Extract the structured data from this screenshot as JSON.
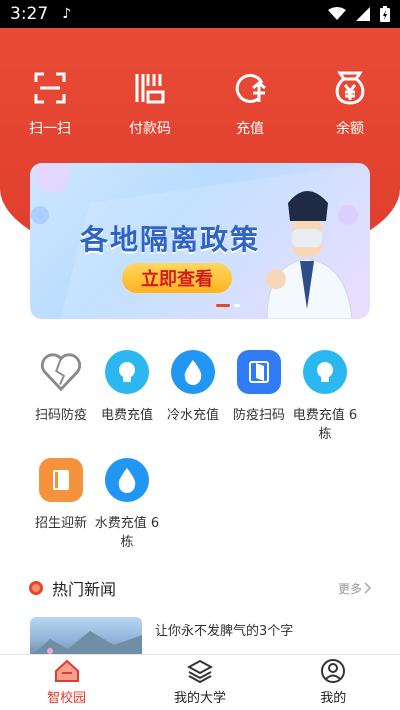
{
  "status_bar": {
    "time": "3:27"
  },
  "quick_actions": [
    {
      "label": "扫一扫",
      "icon": "scan-icon"
    },
    {
      "label": "付款码",
      "icon": "barcode-icon"
    },
    {
      "label": "充值",
      "icon": "recharge-icon"
    },
    {
      "label": "余额",
      "icon": "money-bag-icon"
    }
  ],
  "banner": {
    "title": "各地隔离政策",
    "cta": "立即查看"
  },
  "services": [
    {
      "label": "扫码防疫",
      "icon": "heart-outline-icon",
      "color": "#ffffff"
    },
    {
      "label": "电费充值",
      "icon": "lightbulb-icon",
      "color": "#2bb8f0"
    },
    {
      "label": "冷水充值",
      "icon": "water-drop-icon",
      "color": "#2196f3"
    },
    {
      "label": "防疫扫码",
      "icon": "door-icon",
      "color": "#2f7cf6"
    },
    {
      "label": "电费充值 6栋",
      "icon": "lightbulb-icon",
      "color": "#2bb8f0"
    },
    {
      "label": "招生迎新",
      "icon": "book-icon",
      "color": "#f5933c"
    },
    {
      "label": "水费充值 6栋",
      "icon": "water-drop-icon",
      "color": "#2196f3"
    }
  ],
  "news": {
    "heading": "热门新闻",
    "more": "更多",
    "items": [
      {
        "title": "让你永不发脾气的3个字"
      }
    ]
  },
  "tabs": [
    {
      "label": "智校园",
      "icon": "home-icon",
      "active": true
    },
    {
      "label": "我的大学",
      "icon": "layers-icon",
      "active": false
    },
    {
      "label": "我的",
      "icon": "user-icon",
      "active": false
    }
  ]
}
